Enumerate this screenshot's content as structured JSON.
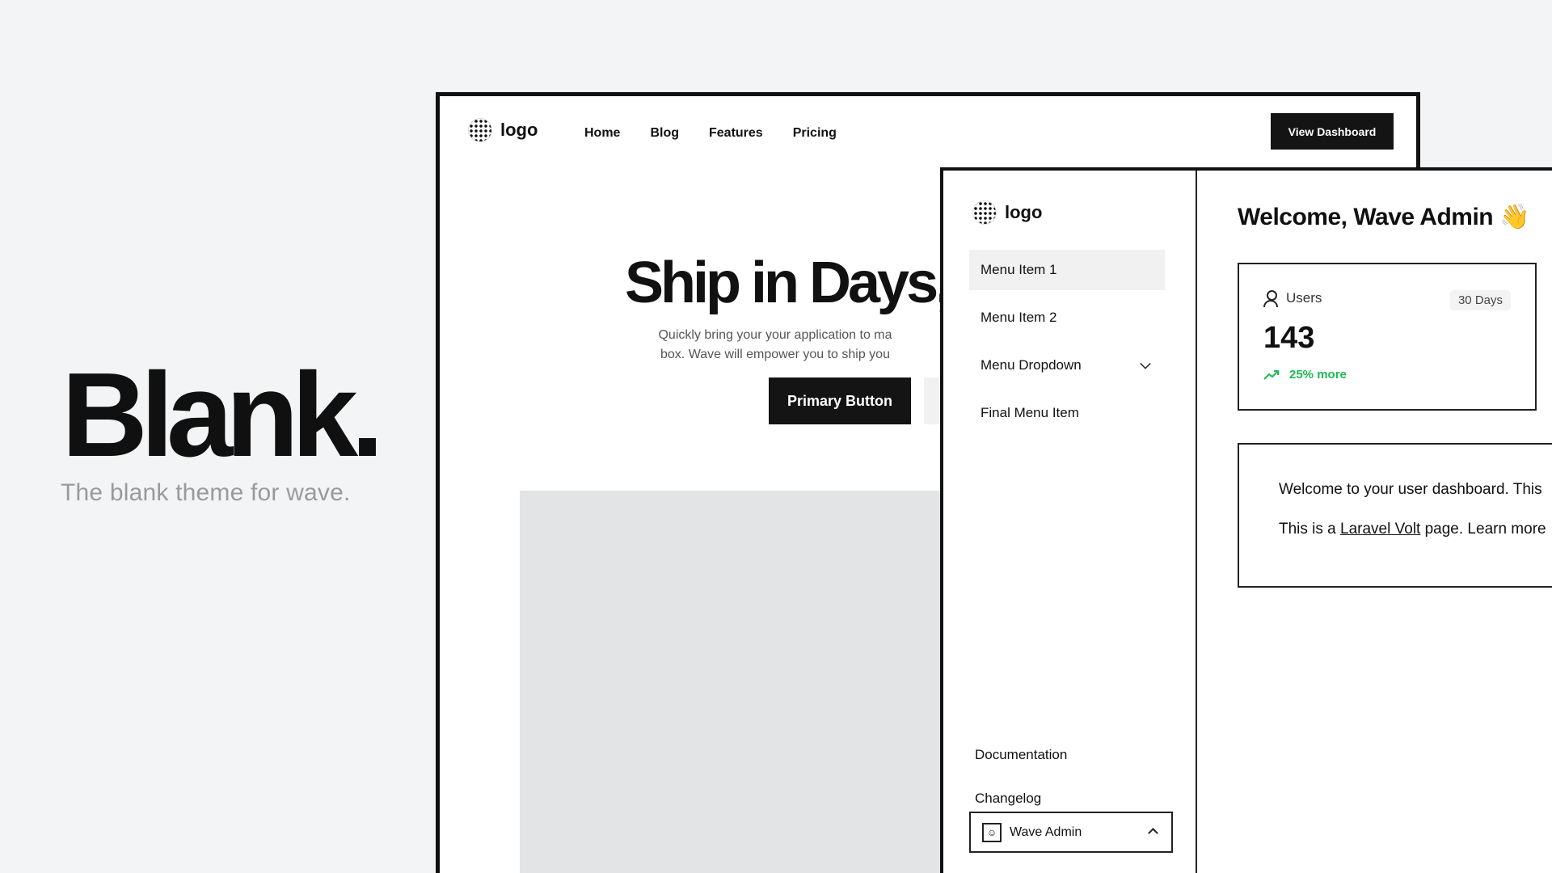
{
  "hero": {
    "title": "Blank.",
    "subtitle": "The blank theme for wave."
  },
  "site": {
    "logo_text": "logo",
    "nav": [
      "Home",
      "Blog",
      "Features",
      "Pricing"
    ],
    "cta_label": "View Dashboard",
    "headline": "Ship in Days,",
    "tagline_line1": "Quickly bring your your application to ma",
    "tagline_line2": "box. Wave will empower you to ship you",
    "primary_button": "Primary Button"
  },
  "dashboard": {
    "logo_text": "logo",
    "menu": [
      {
        "label": "Menu Item 1",
        "active": true
      },
      {
        "label": "Menu Item 2",
        "active": false
      },
      {
        "label": "Menu Dropdown",
        "active": false
      },
      {
        "label": "Final Menu Item",
        "active": false
      }
    ],
    "footer_links": [
      "Documentation",
      "Changelog"
    ],
    "user_name": "Wave Admin",
    "welcome": "Welcome, Wave Admin 👋",
    "stat": {
      "label": "Users",
      "period": "30 Days",
      "value": "143",
      "trend": "25% more",
      "trend_color": "#1db954"
    },
    "info": {
      "line1": "Welcome to your user dashboard. This",
      "line2_prefix": "This is a ",
      "line2_link": "Laravel Volt",
      "line2_suffix": " page. Learn more"
    }
  }
}
